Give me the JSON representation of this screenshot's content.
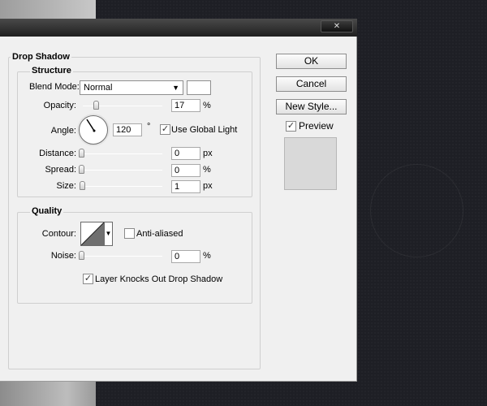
{
  "window": {
    "close_label": "✕"
  },
  "drop_shadow": {
    "title": "Drop Shadow",
    "structure": {
      "title": "Structure",
      "blend_mode_label": "Blend Mode:",
      "blend_mode_value": "Normal",
      "opacity_label": "Opacity:",
      "opacity_value": "17",
      "opacity_unit": "%",
      "opacity_fraction": 0.17,
      "angle_label": "Angle:",
      "angle_value": "120",
      "angle_unit": "°",
      "angle_degrees": 120,
      "use_global_light_label": "Use Global Light",
      "use_global_light_checked": "✓",
      "distance_label": "Distance:",
      "distance_value": "0",
      "distance_unit": "px",
      "spread_label": "Spread:",
      "spread_value": "0",
      "spread_unit": "%",
      "size_label": "Size:",
      "size_value": "1",
      "size_unit": "px"
    },
    "quality": {
      "title": "Quality",
      "contour_label": "Contour:",
      "anti_aliased_label": "Anti-aliased",
      "noise_label": "Noise:",
      "noise_value": "0",
      "noise_unit": "%"
    },
    "layer_knocks_out_label": "Layer Knocks Out Drop Shadow",
    "layer_knocks_out_checked": "✓"
  },
  "buttons": {
    "ok": "OK",
    "cancel": "Cancel",
    "new_style": "New Style..."
  },
  "preview": {
    "label": "Preview",
    "checked": "✓"
  },
  "colors": {
    "dialog_bg": "#f0f0f0",
    "shadow_color": "#ffffff",
    "canvas_bg": "#1e1f25"
  }
}
